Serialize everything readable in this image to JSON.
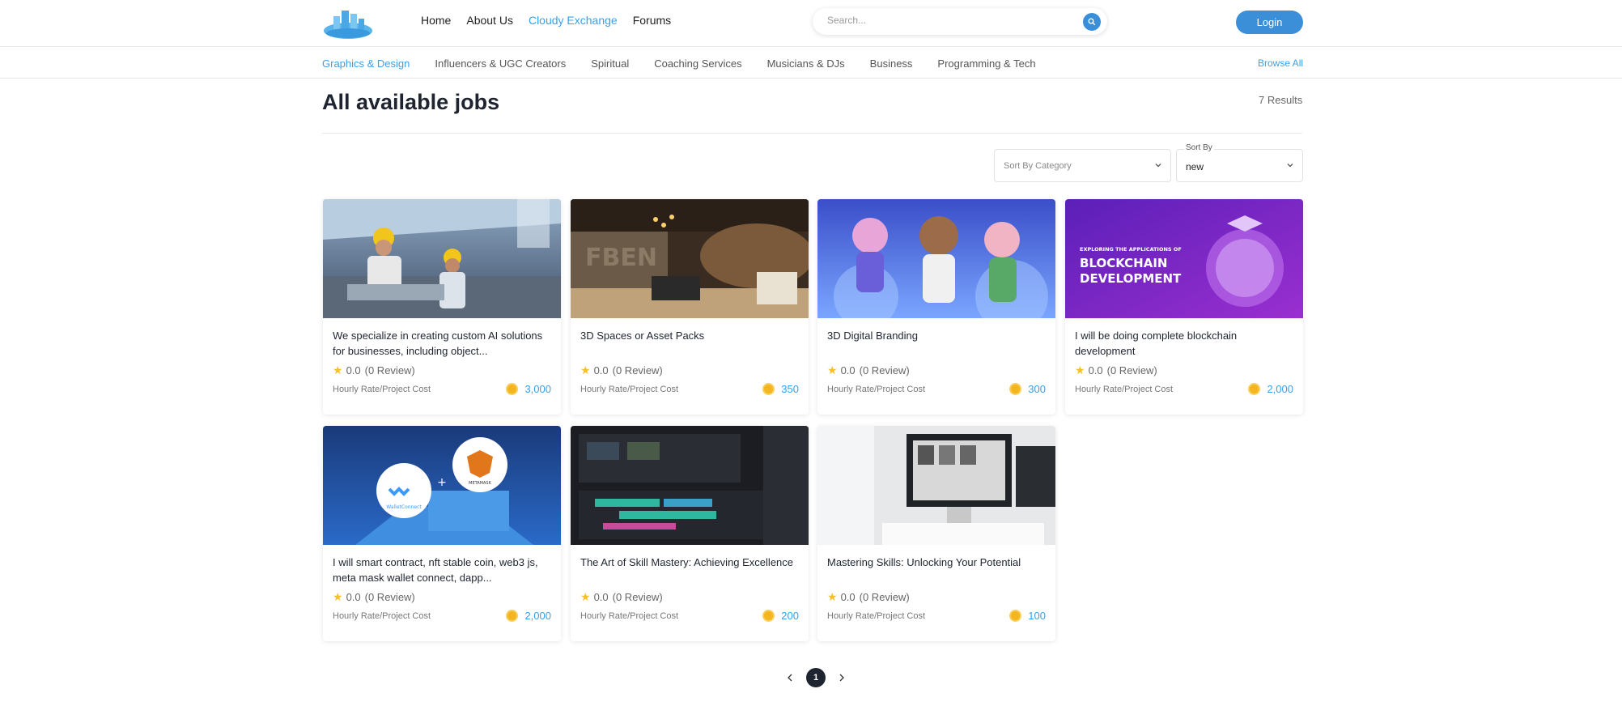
{
  "header": {
    "logo_alt": "CloudyCity.io",
    "nav": [
      {
        "label": "Home",
        "active": false
      },
      {
        "label": "About Us",
        "active": false
      },
      {
        "label": "Cloudy Exchange",
        "active": true
      },
      {
        "label": "Forums",
        "active": false
      }
    ],
    "search_placeholder": "Search...",
    "login_label": "Login"
  },
  "categories": {
    "items": [
      {
        "label": "Graphics & Design",
        "active": true
      },
      {
        "label": "Influencers & UGC Creators",
        "active": false
      },
      {
        "label": "Spiritual",
        "active": false
      },
      {
        "label": "Coaching Services",
        "active": false
      },
      {
        "label": "Musicians & DJs",
        "active": false
      },
      {
        "label": "Business",
        "active": false
      },
      {
        "label": "Programming & Tech",
        "active": false
      }
    ],
    "browse_all": "Browse All"
  },
  "main": {
    "title": "All available jobs",
    "results": "7 Results",
    "sort_category_placeholder": "Sort By Category",
    "sort_by_label": "Sort By",
    "sort_by_value": "new"
  },
  "cards": [
    {
      "title": "We specialize in creating custom AI solutions for businesses, including object...",
      "rating": "0.0",
      "reviews": "(0 Review)",
      "rate_label": "Hourly Rate/Project Cost",
      "price": "3,000",
      "image": "factory-workers"
    },
    {
      "title": "3D Spaces or Asset Packs",
      "rating": "0.0",
      "reviews": "(0 Review)",
      "rate_label": "Hourly Rate/Project Cost",
      "price": "350",
      "image": "3d-gallery"
    },
    {
      "title": "3D Digital Branding",
      "rating": "0.0",
      "reviews": "(0 Review)",
      "rate_label": "Hourly Rate/Project Cost",
      "price": "300",
      "image": "3d-characters"
    },
    {
      "title": "I will be doing complete blockchain development",
      "rating": "0.0",
      "reviews": "(0 Review)",
      "rate_label": "Hourly Rate/Project Cost",
      "price": "2,000",
      "image": "blockchain-banner",
      "banner_small": "EXPLORING THE APPLICATIONS OF",
      "banner_line1": "BLOCKCHAIN",
      "banner_line2": "DEVELOPMENT"
    },
    {
      "title": "I will smart contract, nft stable coin, web3 js, meta mask wallet connect, dapp...",
      "rating": "0.0",
      "reviews": "(0 Review)",
      "rate_label": "Hourly Rate/Project Cost",
      "price": "2,000",
      "image": "walletconnect-metamask",
      "logo_left": "WalletConnect",
      "logo_right": "METAMASK"
    },
    {
      "title": "The Art of Skill Mastery: Achieving Excellence",
      "rating": "0.0",
      "reviews": "(0 Review)",
      "rate_label": "Hourly Rate/Project Cost",
      "price": "200",
      "image": "video-editor"
    },
    {
      "title": "Mastering Skills: Unlocking Your Potential",
      "rating": "0.0",
      "reviews": "(0 Review)",
      "rate_label": "Hourly Rate/Project Cost",
      "price": "100",
      "image": "desk-monitors"
    }
  ],
  "pagination": {
    "current": "1"
  },
  "colors": {
    "accent": "#3aa0e8",
    "button": "#3a8fd8",
    "dark": "#1e2430",
    "star": "#f5c02a",
    "coin": "#f4b51f"
  }
}
